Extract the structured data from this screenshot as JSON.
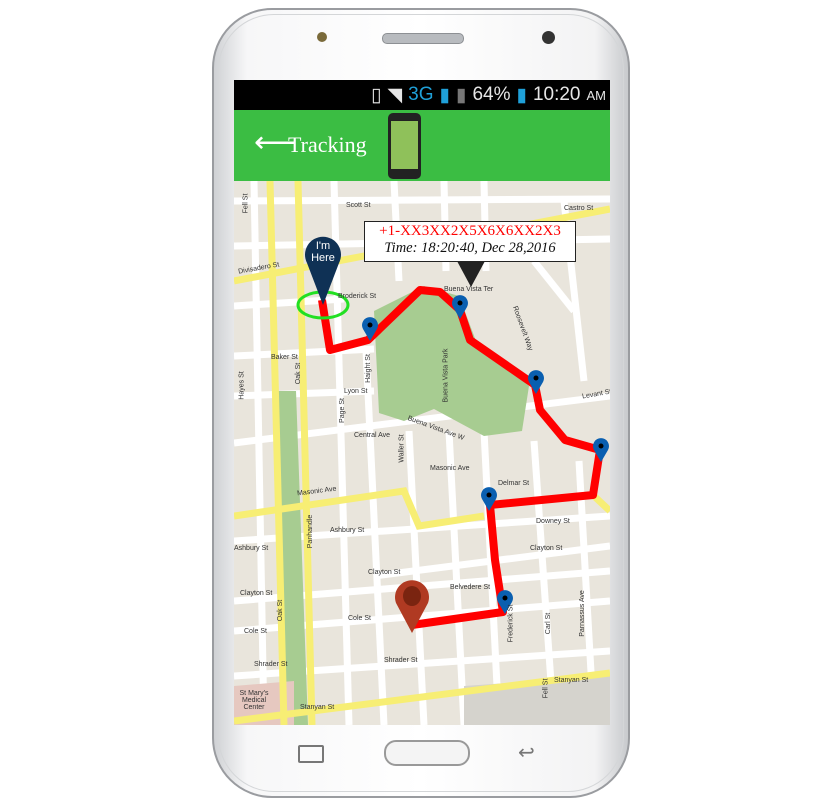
{
  "status_bar": {
    "network": "3G",
    "battery": "64%",
    "time": "10:20",
    "ampm": "AM"
  },
  "app_bar": {
    "title": "Tracking",
    "back_icon": "arrow-left-icon",
    "app_icon": "phone-map-icon"
  },
  "colors": {
    "app_bar": "#3bbd43",
    "route": "#ff0000",
    "pin": "#0a5fb0",
    "destination_pin": "#b03a22",
    "here_pin": "#0f3155",
    "here_ring": "#22e022"
  },
  "map": {
    "here_marker": {
      "line1": "I'm",
      "line2": "Here"
    },
    "info_popup": {
      "phone": "+1-XX3XX2X5X6X6XX2X3",
      "time": "Time: 18:20:40, Dec 28,2016"
    },
    "streets": [
      "Scott St",
      "Castro St",
      "Divisadero St",
      "Broderick St",
      "Buena Vista Ter",
      "Baker St",
      "Lyon St",
      "Haight St",
      "Central Ave",
      "Masonic Ave",
      "Masonic Ave",
      "Delmar St",
      "Downey St",
      "Ashbury St",
      "Ashbury St",
      "Clayton St",
      "Clayton St",
      "Clayton St",
      "Belvedere St",
      "Cole St",
      "Cole St",
      "Shrader St",
      "Shrader St",
      "Stanyan St",
      "Stanyan St",
      "Fell St",
      "Oak St",
      "Fell St",
      "Oak St",
      "Hayes St",
      "Page St",
      "Waller St",
      "Frederick St",
      "Carl St",
      "Parnassus Ave",
      "Levant St",
      "Panhandle",
      "Buena Vista Park",
      "St Mary's Medical Center",
      "Roosevelt Way",
      "Buena Vista Ave W"
    ]
  }
}
